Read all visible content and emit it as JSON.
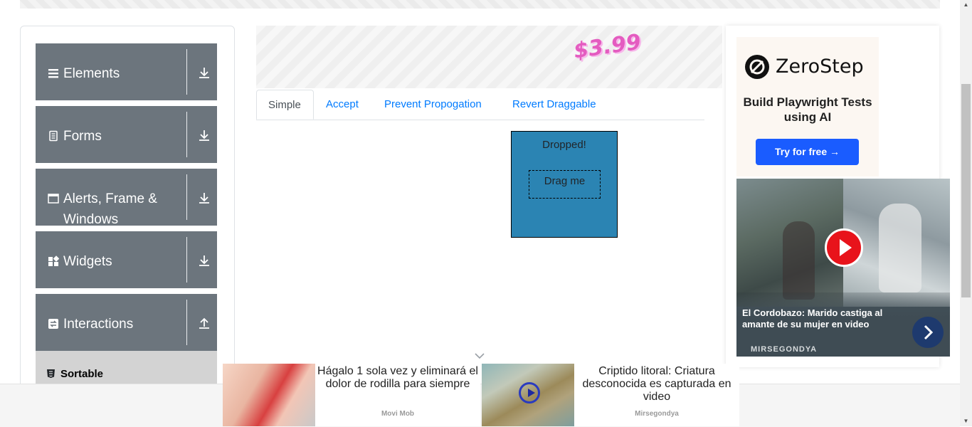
{
  "sidebar": {
    "groups": [
      {
        "label": "Elements",
        "icon": "menu-icon",
        "arrow": "download-arrow-icon"
      },
      {
        "label": "Forms",
        "icon": "document-icon",
        "arrow": "download-arrow-icon"
      },
      {
        "label": "Alerts, Frame & Windows",
        "icon": "window-icon",
        "arrow": "download-arrow-icon"
      },
      {
        "label": "Widgets",
        "icon": "widgets-icon",
        "arrow": "download-arrow-icon"
      },
      {
        "label": "Interactions",
        "icon": "swap-icon",
        "arrow": "upload-arrow-icon"
      }
    ],
    "active_item": {
      "label": "Sortable",
      "icon": "html5-icon"
    }
  },
  "ad_banner": {
    "price": "$3.99"
  },
  "tabs": [
    {
      "label": "Simple",
      "active": true
    },
    {
      "label": "Accept",
      "active": false
    },
    {
      "label": "Prevent Propogation",
      "active": false
    },
    {
      "label": "Revert Draggable",
      "active": false
    }
  ],
  "droppable": {
    "drop_text": "Dropped!",
    "drag_text": "Drag me"
  },
  "right_ad": {
    "brand": "ZeroStep",
    "tagline": "Build Playwright Tests using AI",
    "cta": "Try for free →",
    "video": {
      "title": "El Cordobazo: Marido castiga al amante de su mujer en video",
      "source": "MIRSEGONDYA"
    }
  },
  "bottom_ads": [
    {
      "title": "Hágalo 1 sola vez y eliminará el dolor de rodilla para siempre",
      "source": "Movi Mob"
    },
    {
      "title": "Criptido litoral: Criatura desconocida es capturada en video",
      "source": "Mirsegondya"
    }
  ],
  "colors": {
    "sidebar_group_bg": "#6c757d",
    "active_item_bg": "#d3d3d3",
    "tab_link": "#007bff",
    "dropzone_bg": "#2b84b3",
    "cta_blue": "#1a5cff"
  }
}
